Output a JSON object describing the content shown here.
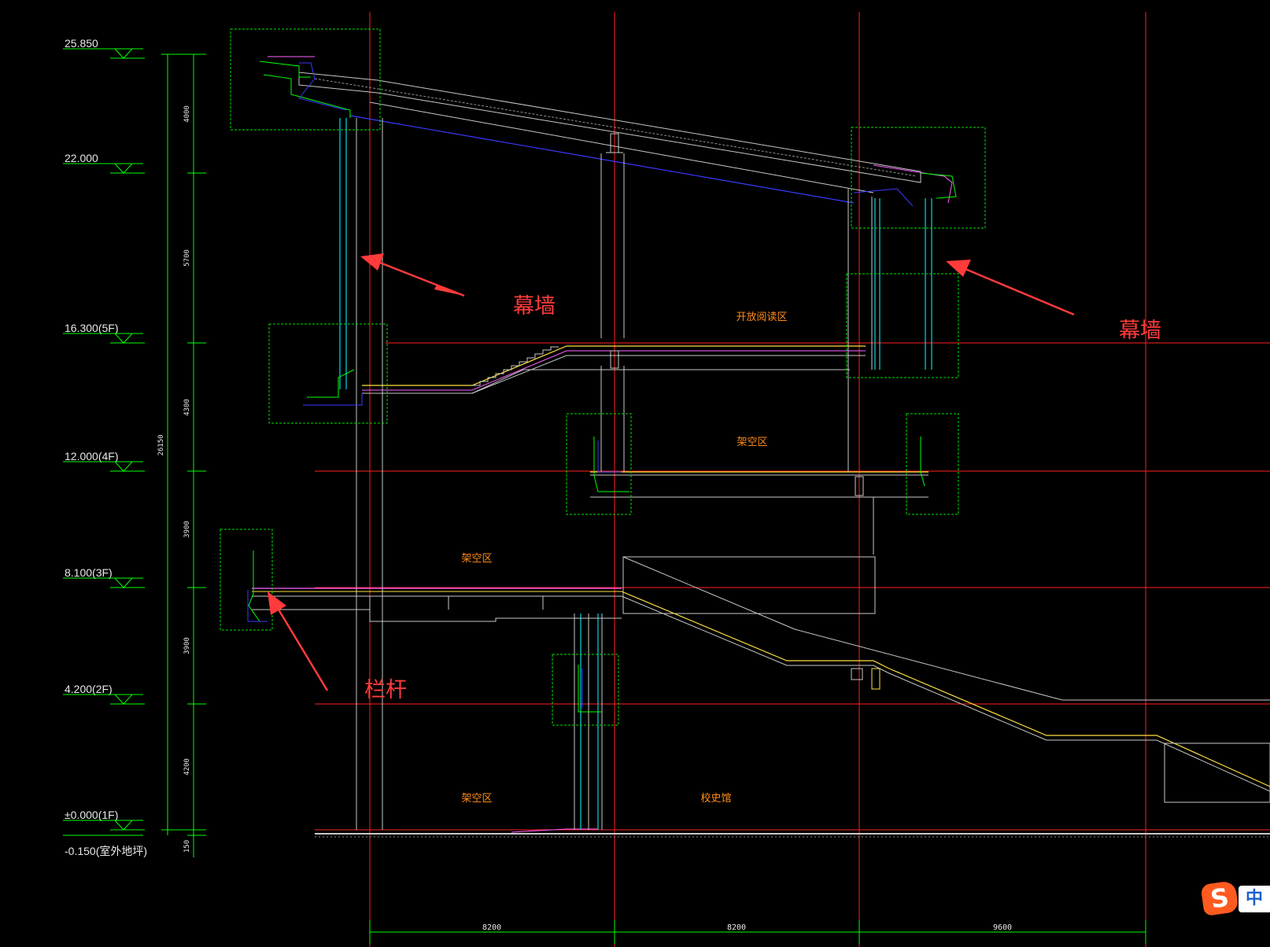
{
  "levels": [
    {
      "label": "25.850"
    },
    {
      "label": "22.000"
    },
    {
      "label": "16.300(5F)"
    },
    {
      "label": "12.000(4F)"
    },
    {
      "label": "8.100(3F)"
    },
    {
      "label": "4.200(2F)"
    },
    {
      "label": "±0.000(1F)"
    },
    {
      "label": "-0.150(室外地坪)"
    }
  ],
  "vertical_dims": [
    "4000",
    "5700",
    "4300",
    "3900",
    "3900",
    "4200",
    "150"
  ],
  "total_height_dim": "26150",
  "bay_dims": [
    "8200",
    "8200",
    "9600"
  ],
  "zones": {
    "open_reading": "开放阅读区",
    "overhead_5f": "架空区",
    "overhead_3f": "架空区",
    "overhead_1f": "架空区",
    "history_hall": "校史馆"
  },
  "callouts": {
    "curtain_wall_left": "幕墙",
    "curtain_wall_right": "幕墙",
    "railing": "栏杆"
  },
  "ime": {
    "logo": "S",
    "mode": "中"
  },
  "colors": {
    "background": "#000000",
    "axis": "#ff2020",
    "dimension": "#00ff00",
    "detail_box": "#00e000",
    "curtain_wall": "#00c8d0",
    "slab": "#c8c8c8",
    "slab_top": "#ffe040",
    "slab_finish": "#ff60ff",
    "structure_blue": "#3a3aff",
    "zone_text": "#ff8c1a",
    "callout": "#ff3b3b"
  }
}
